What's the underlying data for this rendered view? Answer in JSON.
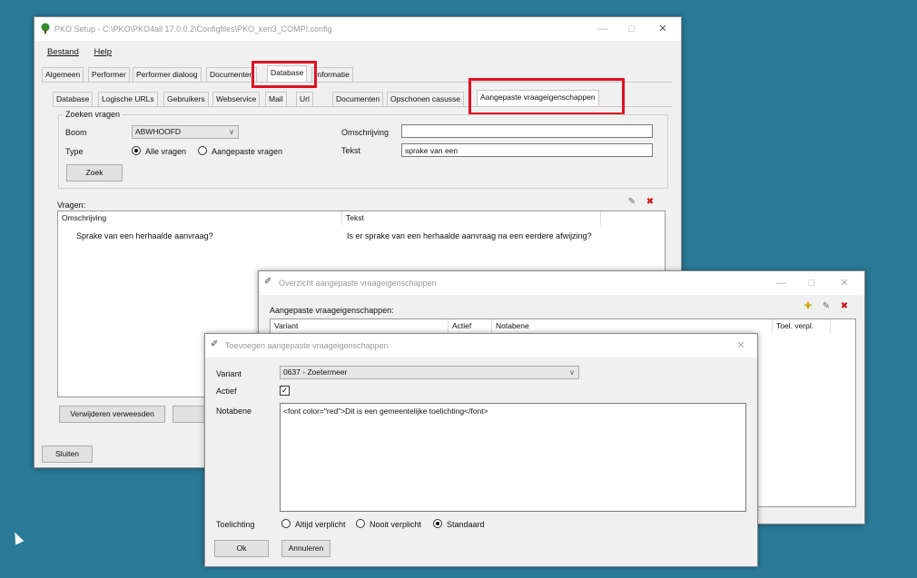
{
  "main_window": {
    "title": "PKO Setup - C:\\PKO\\PKO4all 17.0.0.2\\Configfiles\\PKO_ken3_COMPI.config",
    "menu": [
      "Bestand",
      "Help"
    ],
    "top_tabs": [
      "Algemeen",
      "Performer",
      "Performer dialoog",
      "Documenten",
      "Database",
      "Informatie"
    ],
    "sub_tabs": [
      "Database",
      "Logische URLs",
      "Gebruikers",
      "Webservice",
      "Mail",
      "Url",
      "Documenten",
      "Opschonen casusse",
      "Aangepaste vraageigenschappen"
    ],
    "search": {
      "group_label": "Zoeken vragen",
      "boom_label": "Boom",
      "boom_value": "ABWHOOFD",
      "type_label": "Type",
      "type_options": [
        "Alle vragen",
        "Aangepaste vragen"
      ],
      "omschrijving_label": "Omschrijving",
      "omschrijving_value": "",
      "tekst_label": "Tekst",
      "tekst_value": "sprake van een",
      "zoek_button": "Zoek"
    },
    "vragen_label": "Vragen:",
    "vragen_columns": [
      "Omschrijving",
      "Tekst"
    ],
    "vragen_rows": [
      {
        "omschrijving": "Sprake van een herhaalde aanvraag?",
        "tekst": "Is er sprake van een herhaalde aanvraag na een eerdere afwijzing?"
      }
    ],
    "remove_button": "Verwijderen verweesden",
    "close_button": "Sluiten"
  },
  "overview_window": {
    "title": "Overzicht aangepaste vraageigenschappen",
    "list_label": "Aangepaste vraageigenschappen:",
    "columns": [
      "Variant",
      "Actief",
      "Notabene",
      "Toel. verpl."
    ]
  },
  "add_dialog": {
    "title": "Toevoegen aangepaste vraageigenschappen",
    "variant_label": "Variant",
    "variant_value": "0637 - Zoetermeer",
    "actief_label": "Actief",
    "notabene_label": "Notabene",
    "notabene_value": "<font color=\"red\">Dit is een gemeentelijke toelichting</font>",
    "toelichting_label": "Toelichting",
    "toelichting_options": [
      "Altijd verplicht",
      "Nooit verplicht",
      "Standaard"
    ],
    "ok_button": "Ok",
    "cancel_button": "Annuleren"
  },
  "colors": {
    "desktop": "#2a7a98",
    "highlight": "#e01020"
  }
}
